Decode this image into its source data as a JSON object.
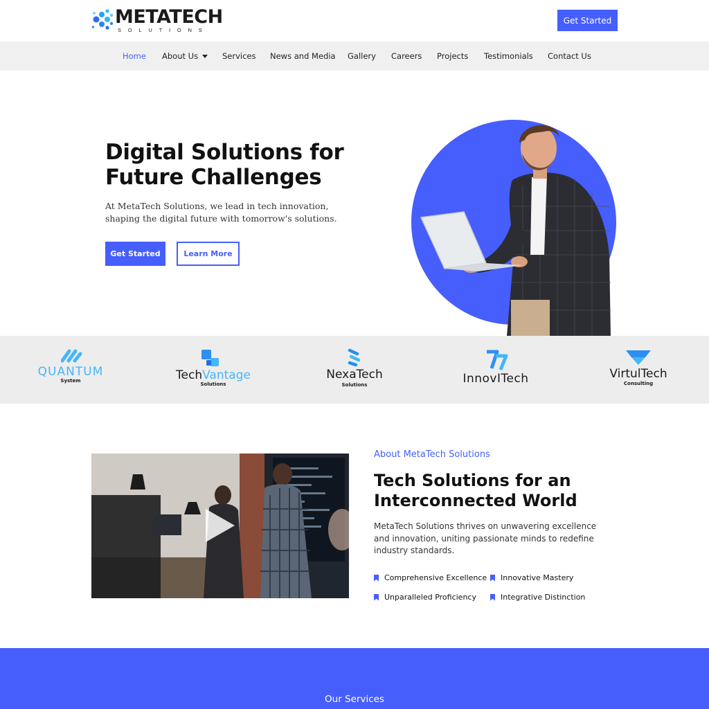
{
  "brand": {
    "name": "METATECH",
    "tagline": "SOLUTIONS"
  },
  "header": {
    "cta_label": "Get Started"
  },
  "nav": {
    "items": [
      {
        "label": "Home",
        "active": true
      },
      {
        "label": "About Us",
        "has_dropdown": true
      },
      {
        "label": "Services"
      },
      {
        "label": "News and Media"
      },
      {
        "label": "Gallery"
      },
      {
        "label": "Careers"
      },
      {
        "label": "Projects"
      },
      {
        "label": "Testimonials"
      },
      {
        "label": "Contact Us"
      }
    ]
  },
  "hero": {
    "title": "Digital Solutions for Future Challenges",
    "text": "At MetaTech Solutions, we lead in tech innovation, shaping the digital future with tomorrow's solutions.",
    "primary_label": "Get Started",
    "secondary_label": "Learn More"
  },
  "partners": [
    {
      "name": "QUANTUM",
      "sub": "System",
      "icon": "quantum-logo-icon"
    },
    {
      "name_a": "Tech",
      "name_b": "Vantage",
      "sub": "Solutions",
      "icon": "techvantage-logo-icon"
    },
    {
      "name": "NexaTech",
      "sub": "Solutions",
      "icon": "nexatech-logo-icon"
    },
    {
      "name": "InnovITech",
      "sub": "",
      "icon": "innovitech-logo-icon"
    },
    {
      "name": "VirtulTech",
      "sub": "Consulting",
      "icon": "virtultech-logo-icon"
    }
  ],
  "about": {
    "kicker": "About MetaTech Solutions",
    "title": "Tech Solutions for an Interconnected World",
    "text": "MetaTech Solutions thrives on unwavering excellence and innovation, uniting passionate minds to redefine industry standards.",
    "features": [
      "Comprehensive Excellence",
      "Innovative Mastery",
      "Unparalleled Proficiency",
      "Integrative Distinction"
    ]
  },
  "services": {
    "title": "Our Services"
  },
  "colors": {
    "accent": "#465efc",
    "strip_bg": "#ededed",
    "nav_bg": "#f0f0f0",
    "logo_cyan": "#2fb1f4"
  }
}
